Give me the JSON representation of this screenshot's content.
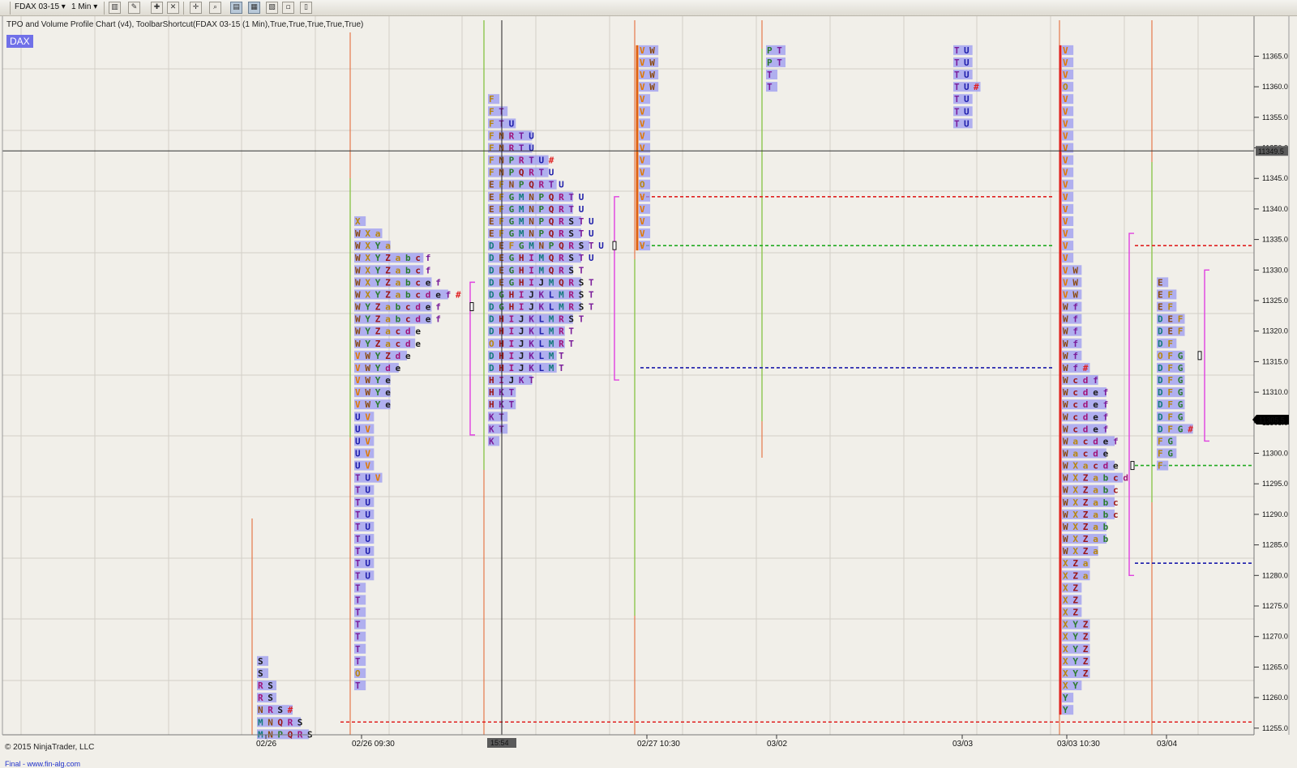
{
  "toolbar": {
    "instrument": "FDAX 03-15",
    "interval": "1 Min"
  },
  "chart_title": "TPO and Volume Profile Chart (v4), ToolbarShortcut(FDAX 03-15 (1 Min),True,True,True,True,True)",
  "instrument_badge": "DAX",
  "copyright": "© 2015 NinjaTrader, LLC",
  "footer_link": "Final - www.fin-alg.com",
  "colors": {
    "background": "#f1efe9",
    "volume_bar": "#9a9af0",
    "poc_level": "#22aa22",
    "vah_level": "#e02020",
    "val_level": "#1a1aaa",
    "value_area_bracket": "#e040e0",
    "current_price_tag": "#000000"
  },
  "chart_data": {
    "type": "tpo_volume_profile",
    "title": "TPO and Volume Profile Chart (v4)",
    "ylim": [
      11252,
      11370
    ],
    "tick_size": 2,
    "y_ticks": [
      11255,
      11260,
      11265,
      11270,
      11275,
      11280,
      11285,
      11290,
      11295,
      11300,
      11305,
      11310,
      11315,
      11320,
      11325,
      11330,
      11335,
      11340,
      11345,
      11350,
      11355,
      11360,
      11365
    ],
    "y_tick_labels": [
      "11255.0",
      "11260.0",
      "11265.0",
      "11270.0",
      "11275.0",
      "11280.0",
      "11285.0",
      "11290.0",
      "11295.0",
      "11300.0",
      "11305.0",
      "11310.0",
      "11315.0",
      "11320.0",
      "11325.0",
      "11330.0",
      "11335.0",
      "11340.0",
      "11345.0",
      "11350.0",
      "11355.0",
      "11360.0",
      "11365.0"
    ],
    "x_labels": [
      "02/26",
      "02/26 09:30",
      "02/27 10:30",
      "03/02",
      "03/03",
      "03/03 10:30",
      "03/04"
    ],
    "crosshair": {
      "price": 11349.5,
      "price_label": "11349.5",
      "time_label": "15:54"
    },
    "last_price": {
      "value": 11305.5,
      "label": "11305.5"
    },
    "levels": [
      {
        "type": "vah",
        "price": 11342
      },
      {
        "type": "poc",
        "price": 11334
      },
      {
        "type": "val",
        "price": 11314
      },
      {
        "type": "vah",
        "price": 11334
      },
      {
        "type": "poc",
        "price": 11298
      },
      {
        "type": "val",
        "price": 11282
      },
      {
        "type": "vah",
        "price": 11256
      }
    ],
    "profiles": [
      {
        "name": "02/26 late",
        "top_price": 11266,
        "rows": [
          "S",
          "S",
          "RS",
          "RS",
          "NRS#",
          "MNQRS",
          "MNPQRS"
        ]
      },
      {
        "name": "02/26",
        "top_price": 11338,
        "rows": [
          "X",
          "WXa",
          "WXYa",
          "WXYZabcf",
          "WXYZabcf",
          "WXYZabcef",
          "WXYZabcdef#",
          "WYZabcdef",
          "WYZabcdef",
          "WYZacde",
          "WYZacde",
          "VWYZde",
          "VWYde",
          "VWYe",
          "VWYe",
          "VWYe",
          "UV",
          "UV",
          "UV",
          "UV",
          "UV",
          "TUV",
          "TU",
          "TU",
          "TU",
          "TU",
          "TU",
          "TU",
          "TU",
          "TU",
          "T",
          "T",
          "T",
          "T",
          "T",
          "T",
          "T",
          "O",
          "T"
        ]
      },
      {
        "name": "02/27",
        "top_price": 11358,
        "rows": [
          "F",
          "FT",
          "FTU",
          "FNRTU",
          "FNRTU",
          "FNPRTU#",
          "FNPQRTU",
          "EFNPQRTU",
          "EFGMNPQRTU",
          "EFGMNPQRTU",
          "EFGMNPQRSTU",
          "EFGMNPQRSTU",
          "DEFGMNPQRSTU",
          "DEGHIMQRSTU",
          "DEGHIMQRST",
          "DEGHIJMQRST",
          "DGHIJKLMRST",
          "DGHIJKLMRST",
          "DHIJKLMRST",
          "DHIJKLMRT",
          "OHIJKLMRT",
          "DHIJKLMT",
          "DHIJKLMT",
          "HIJKT",
          "HKT",
          "HKT",
          "KT",
          "KT",
          "K"
        ]
      },
      {
        "name": "02/27 late",
        "top_price": 11366,
        "rows": [
          "VW",
          "VW",
          "VW",
          "VW",
          "V",
          "V",
          "V",
          "V",
          "V",
          "V",
          "V",
          "O",
          "V",
          "V",
          "V",
          "V",
          "V"
        ]
      },
      {
        "name": "03/02",
        "top_price": 11366,
        "rows": [
          "PT",
          "PT",
          "T",
          "T"
        ]
      },
      {
        "name": "03/03 early",
        "top_price": 11366,
        "rows": [
          "TU",
          "TU",
          "TU",
          "TU#",
          "TU",
          "TU",
          "TU"
        ]
      },
      {
        "name": "03/03",
        "top_price": 11366,
        "rows": [
          "V",
          "V",
          "V",
          "O",
          "V",
          "V",
          "V",
          "V",
          "V",
          "V",
          "V",
          "V",
          "V",
          "V",
          "V",
          "V",
          "V",
          "V",
          "VW",
          "VW",
          "VW",
          "Wf",
          "Wf",
          "Wf",
          "Wf",
          "Wf",
          "Wf#",
          "Wcdf",
          "Wcdef",
          "Wcdef",
          "Wcdef",
          "Wcdef",
          "Wacdef",
          "Wacde",
          "WXacde",
          "WXZabcd",
          "WXZabc",
          "WXZabc",
          "WXZabc",
          "WXZab",
          "WXZab",
          "WXZa",
          "XZa",
          "XZa",
          "XZ",
          "XZ",
          "XZ",
          "XYZ",
          "XYZ",
          "XYZ",
          "XYZ",
          "XYZ",
          "XY",
          "Y",
          "Y"
        ]
      },
      {
        "name": "03/04",
        "top_price": 11328,
        "rows": [
          "E",
          "EF",
          "EF",
          "DEF",
          "DEF",
          "DF",
          "OFG",
          "DFG",
          "DFG",
          "DFG",
          "DFG",
          "DFG",
          "DFG#",
          "FG",
          "FG",
          "F"
        ]
      }
    ]
  }
}
